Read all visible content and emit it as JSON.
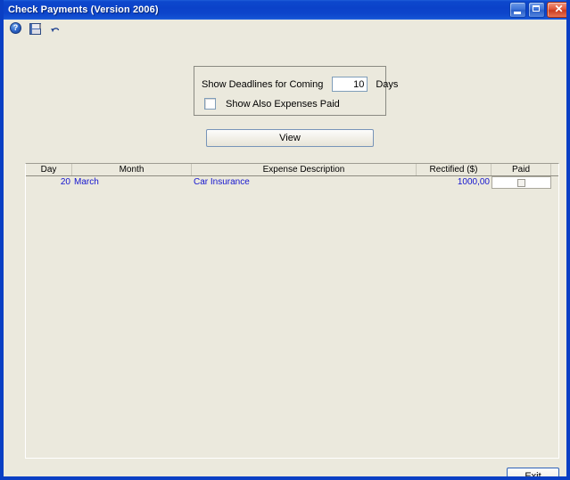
{
  "window": {
    "title": "Check Payments (Version 2006)",
    "controls": {
      "minimize_label": "Minimize",
      "maximize_label": "Maximize",
      "close_label": "✕"
    },
    "frame_color": "#0a3fc4",
    "client_color": "#ebe9dd"
  },
  "toolbar": {
    "items": [
      {
        "icon": "help-icon",
        "label": "?",
        "name": "help-button"
      },
      {
        "icon": "save-icon",
        "label": "",
        "name": "save-button"
      },
      {
        "icon": "undo-icon",
        "label": "",
        "name": "undo-button"
      }
    ]
  },
  "options": {
    "deadline_label": "Show Deadlines for Coming",
    "days_value": "10",
    "days_placeholder": "0",
    "days_suffix": "Days",
    "show_paid_label": "Show Also Expenses Paid",
    "show_paid_checked": false
  },
  "actions": {
    "view_label": "View",
    "exit_label": "Exit"
  },
  "grid": {
    "columns": [
      {
        "key": "day",
        "label": "Day"
      },
      {
        "key": "month",
        "label": "Month"
      },
      {
        "key": "desc",
        "label": "Expense Description"
      },
      {
        "key": "rect",
        "label": "Rectified ($)"
      },
      {
        "key": "paid",
        "label": "Paid"
      }
    ],
    "rows": [
      {
        "day": "20",
        "month": "March",
        "desc": "Car Insurance",
        "rect": "1000,00",
        "paid_checked": false
      }
    ],
    "row_text_color": "#1414cf"
  }
}
